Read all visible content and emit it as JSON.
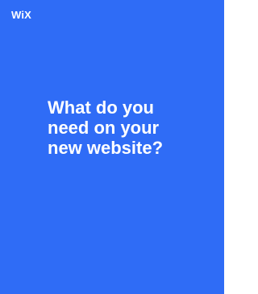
{
  "brand": {
    "logo_text": "WiX"
  },
  "main": {
    "headline_lines": [
      "What do you",
      "need on your",
      "new website?"
    ]
  },
  "colors": {
    "panel_background": "#2f6cf6",
    "text": "#ffffff",
    "page_background": "#ffffff"
  }
}
